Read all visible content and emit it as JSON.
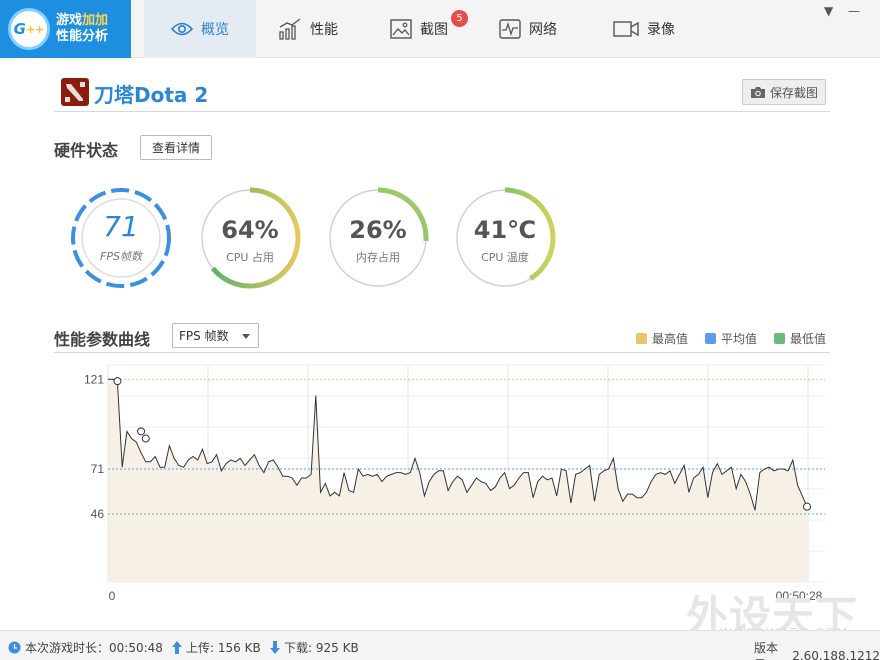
{
  "app": {
    "logo_line1_a": "游戏",
    "logo_line1_b": "加加",
    "logo_line2": "性能分析",
    "logo_badge": "G++"
  },
  "tabs": [
    {
      "label": "概览",
      "icon": "eye-icon"
    },
    {
      "label": "性能",
      "icon": "bar-chart-icon"
    },
    {
      "label": "截图",
      "icon": "picture-icon",
      "badge": "5"
    },
    {
      "label": "网络",
      "icon": "pulse-icon"
    },
    {
      "label": "录像",
      "icon": "video-camera-icon"
    }
  ],
  "window": {
    "dropdown": "▼",
    "minimize": "—"
  },
  "game": {
    "title": "刀塔Dota 2",
    "save_label": "保存截图"
  },
  "hardware": {
    "title": "硬件状态",
    "detail_label": "查看详情",
    "gauges": [
      {
        "value": "71",
        "label": "FPS帧数",
        "progress": 1.0
      },
      {
        "value": "64%",
        "label": "CPU 占用",
        "progress": 0.64
      },
      {
        "value": "26%",
        "label": "内存占用",
        "progress": 0.26
      },
      {
        "value": "41℃",
        "label": "CPU 温度",
        "progress": 0.41
      }
    ]
  },
  "curve": {
    "title": "性能参数曲线",
    "select_value": "FPS 帧数",
    "legend": [
      {
        "label": "最高值",
        "color": "#e8c46a"
      },
      {
        "label": "平均值",
        "color": "#5b9de8"
      },
      {
        "label": "最低值",
        "color": "#6dbb7a"
      }
    ]
  },
  "chart_data": {
    "type": "line",
    "y_ticks": [
      "121",
      "71",
      "46"
    ],
    "max_value": 121,
    "avg_value": 71,
    "min_value": 46,
    "x_start_label": "0",
    "x_end_label": "00:50:28",
    "ylim": [
      8,
      129
    ],
    "values": [
      121,
      121,
      120,
      72,
      92,
      88,
      86,
      80,
      75,
      75,
      78,
      72,
      72,
      84,
      77,
      73,
      72,
      76,
      78,
      76,
      82,
      74,
      75,
      79,
      70,
      74,
      76,
      75,
      77,
      73,
      76,
      79,
      73,
      69,
      75,
      76,
      72,
      67,
      67,
      66,
      62,
      66,
      66,
      68,
      112,
      58,
      63,
      56,
      58,
      56,
      69,
      59,
      58,
      71,
      67,
      68,
      67,
      68,
      64,
      67,
      68,
      69,
      69,
      68,
      69,
      77,
      69,
      56,
      64,
      68,
      70,
      70,
      59,
      64,
      67,
      65,
      58,
      62,
      66,
      64,
      63,
      59,
      61,
      66,
      69,
      60,
      62,
      66,
      69,
      69,
      55,
      64,
      67,
      65,
      66,
      56,
      71,
      70,
      52,
      68,
      69,
      71,
      73,
      53,
      68,
      70,
      71,
      77,
      60,
      53,
      57,
      57,
      55,
      55,
      58,
      64,
      68,
      69,
      68,
      70,
      63,
      68,
      73,
      58,
      66,
      68,
      72,
      55,
      69,
      74,
      68,
      70,
      72,
      60,
      68,
      64,
      57,
      48,
      69,
      71,
      72,
      70,
      71,
      71,
      70,
      76,
      62,
      56,
      50
    ]
  },
  "footer": {
    "play_time_label": "本次游戏时长：",
    "play_time": "00:50:48",
    "upload_label": "上传:",
    "upload": "156 KB",
    "download_label": "下载:",
    "download": "925 KB",
    "version_label": "版本号：",
    "version": "2.60.188.1212"
  },
  "colors": {
    "accent": "#2b86d6",
    "max_line": "#e8c46a",
    "avg_line": "#5b9de8",
    "min_line": "#6dbb7a"
  }
}
